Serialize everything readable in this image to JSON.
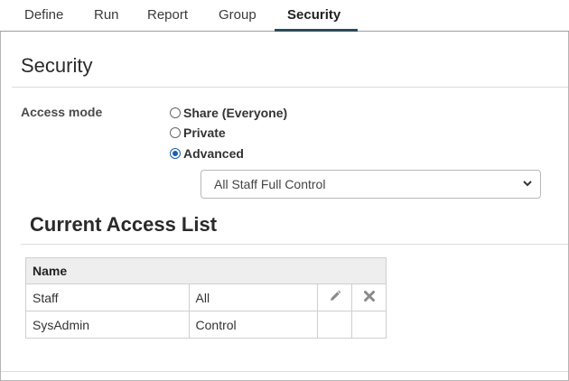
{
  "tabs": [
    {
      "label": "Define"
    },
    {
      "label": "Run"
    },
    {
      "label": "Report"
    },
    {
      "label": "Group"
    },
    {
      "label": "Security"
    }
  ],
  "active_tab": "Security",
  "page": {
    "title": "Security"
  },
  "access_mode": {
    "label": "Access mode",
    "options": [
      {
        "label": "Share (Everyone)",
        "checked": false
      },
      {
        "label": "Private",
        "checked": false
      },
      {
        "label": "Advanced",
        "checked": true
      }
    ],
    "select_value": "All Staff Full Control"
  },
  "access_list": {
    "title": "Current Access List",
    "header": "Name",
    "rows": [
      {
        "name": "Staff",
        "permission": "All"
      },
      {
        "name": "SysAdmin",
        "permission": "Control"
      }
    ]
  },
  "icons": {
    "edit": "pencil-icon",
    "delete": "x-icon",
    "dropdown": "chevron-down-icon"
  },
  "colors": {
    "accent": "#2b4a5c",
    "radio": "#1a5fb4"
  }
}
